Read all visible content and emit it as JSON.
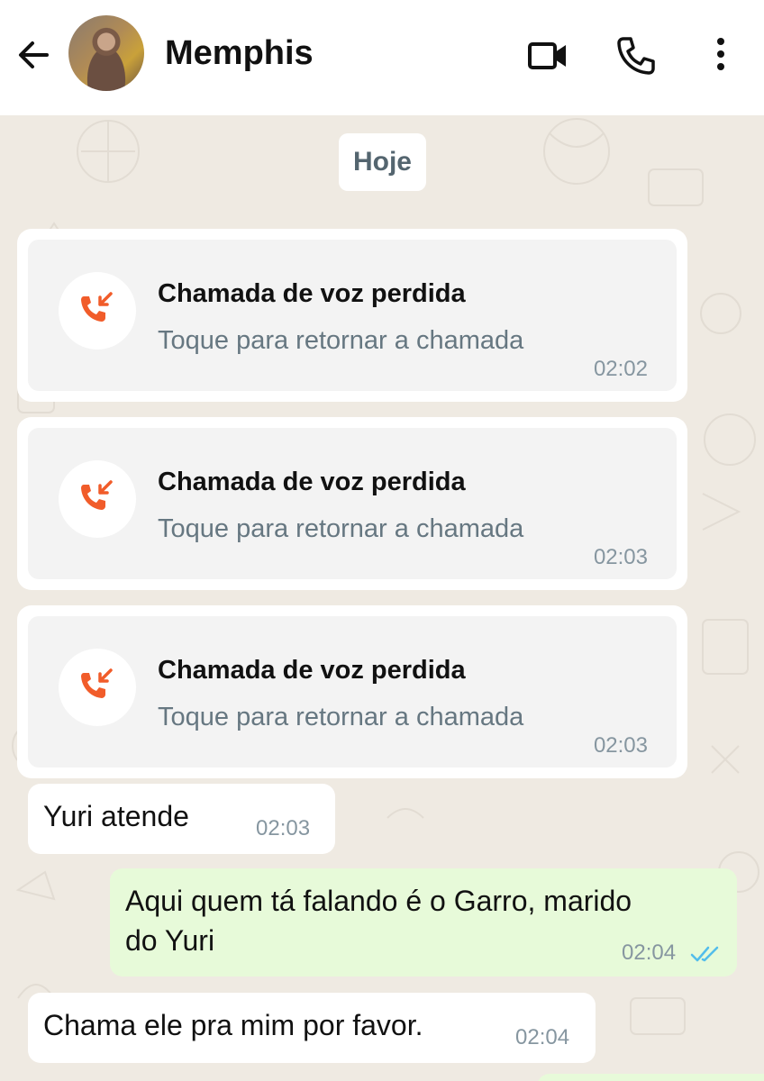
{
  "header": {
    "back_icon": "arrow-left-icon",
    "contact_name": "Memphis",
    "video_icon": "video-camera-icon",
    "phone_icon": "phone-icon",
    "menu_icon": "more-vertical-icon"
  },
  "chat": {
    "date_chip": "Hoje",
    "missed_calls": [
      {
        "title": "Chamada de voz perdida",
        "subtitle": "Toque para retornar a chamada",
        "time": "02:02"
      },
      {
        "title": "Chamada de voz perdida",
        "subtitle": "Toque para retornar a chamada",
        "time": "02:03"
      },
      {
        "title": "Chamada de voz perdida",
        "subtitle": "Toque para retornar a chamada",
        "time": "02:03"
      }
    ],
    "messages": [
      {
        "direction": "in",
        "lines": [
          "Yuri atende"
        ],
        "time": "02:03"
      },
      {
        "direction": "out",
        "lines": [
          "Aqui quem tá falando é o Garro, marido",
          "do Yuri"
        ],
        "time": "02:04",
        "status": "read"
      },
      {
        "direction": "in",
        "lines": [
          "Chama ele pra mim por favor."
        ],
        "time": "02:04"
      }
    ]
  },
  "colors": {
    "wallpaper": "#efeae2",
    "missed_call_icon": "#f15c2a",
    "read_ticks": "#53bdeb",
    "outgoing_bubble": "#e7fad9"
  }
}
